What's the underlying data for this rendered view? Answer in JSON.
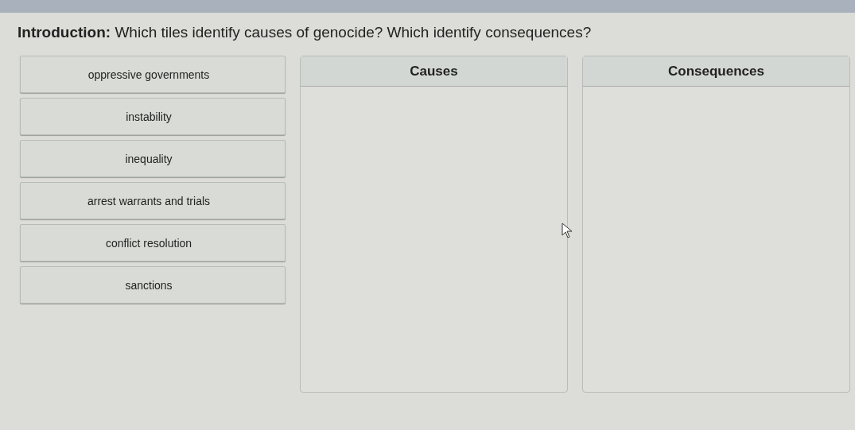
{
  "prompt": "**Introduction:** Which tiles identify causes of genocide? Which identify consequences?",
  "tiles": [
    {
      "label": "oppressive governments"
    },
    {
      "label": "instability"
    },
    {
      "label": "inequality"
    },
    {
      "label": "arrest warrants and trials"
    },
    {
      "label": "conflict resolution"
    },
    {
      "label": "sanctions"
    }
  ],
  "bins": [
    {
      "title": "Causes"
    },
    {
      "title": "Consequences"
    }
  ]
}
